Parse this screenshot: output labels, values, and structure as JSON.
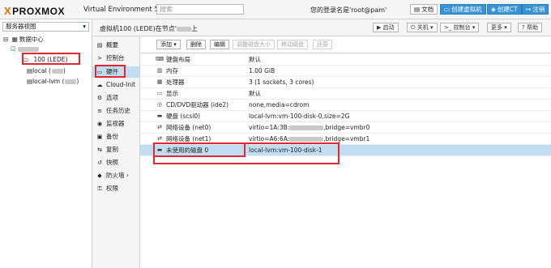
{
  "header": {
    "logo_mark": "X",
    "logo_text": "PROXMOX",
    "version": "Virtual Environment 5.3-8",
    "search_placeholder": "搜索",
    "user_label": "您的登录名是'root@pam'",
    "buttons": [
      {
        "label": "文档",
        "icon": "book-icon"
      },
      {
        "label": "创建虚拟机",
        "icon": "monitor-icon"
      },
      {
        "label": "创建CT",
        "icon": "cube-icon"
      },
      {
        "label": "注销",
        "icon": "logout-icon"
      }
    ]
  },
  "sidebar": {
    "view_selector": "服务器视图",
    "tree": {
      "datacenter": "数据中心",
      "vm": "100 (LEDE)",
      "storage_local": "local (",
      "storage_lvm": "local-lvm ("
    }
  },
  "main_header": {
    "title_prefix": "虚拟机100 (LEDE)在节点'",
    "title_suffix": "上",
    "buttons": [
      "启动",
      "关机",
      "控制台",
      "更多",
      "帮助"
    ]
  },
  "menu": {
    "items": [
      {
        "label": "概要",
        "icon": "summary-icon"
      },
      {
        "label": "控制台",
        "icon": "console-icon"
      },
      {
        "label": "硬件",
        "icon": "monitor-icon"
      },
      {
        "label": "Cloud-Init",
        "icon": "cloud-icon"
      },
      {
        "label": "选项",
        "icon": "gear-icon"
      },
      {
        "label": "任务历史",
        "icon": "list-icon"
      },
      {
        "label": "监视器",
        "icon": "eye-icon"
      },
      {
        "label": "备份",
        "icon": "floppy-icon"
      },
      {
        "label": "复制",
        "icon": "retweet-icon"
      },
      {
        "label": "快照",
        "icon": "history-icon"
      },
      {
        "label": "防火墙",
        "icon": "shield-icon"
      },
      {
        "label": "权限",
        "icon": "unlock-icon"
      }
    ],
    "selected_index": 2
  },
  "toolbar": {
    "buttons": [
      {
        "label": "添加",
        "disabled": false,
        "dropdown": true
      },
      {
        "label": "删除",
        "disabled": false
      },
      {
        "label": "编辑",
        "disabled": false
      },
      {
        "label": "调整磁盘大小",
        "disabled": true
      },
      {
        "label": "移动磁盘",
        "disabled": true
      },
      {
        "label": "还原",
        "disabled": true
      }
    ]
  },
  "hardware": {
    "rows": [
      {
        "key": "键盘布局",
        "value": "默认",
        "icon": "keyboard-icon"
      },
      {
        "key": "内存",
        "value": "1.00 GiB",
        "icon": "memory-icon"
      },
      {
        "key": "处理器",
        "value": "3 (1 sockets, 3 cores)",
        "icon": "cpu-icon"
      },
      {
        "key": "显示",
        "value": "默认",
        "icon": "display-icon"
      },
      {
        "key": "CD/DVD驱动器 (ide2)",
        "value": "none,media=cdrom",
        "icon": "cdrom-icon"
      },
      {
        "key": "硬盘 (scsi0)",
        "value": "local-lvm:vm-100-disk-0,size=2G",
        "icon": "harddisk-icon"
      },
      {
        "key": "网络设备 (net0)",
        "value": "virtio=1A:3B:",
        "value_suffix": ",bridge=vmbr0",
        "icon": "network-icon"
      },
      {
        "key": "网络设备 (net1)",
        "value": "virtio=A6:6A:",
        "value_suffix": ",bridge=vmbr1",
        "icon": "network-icon"
      },
      {
        "key": "未使用的磁盘 0",
        "value": "local-lvm:vm-100-disk-1",
        "icon": "harddisk-icon"
      }
    ],
    "selected_index": 8
  }
}
